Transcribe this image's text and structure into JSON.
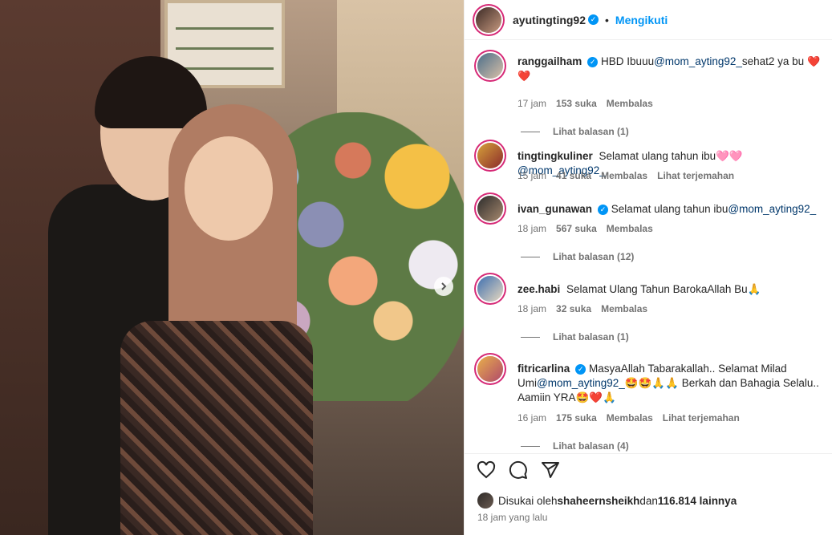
{
  "post": {
    "author": "ayutingting92",
    "follow_status": "Mengikuti",
    "separator": "•"
  },
  "comments": [
    {
      "username": "ranggailham",
      "verified": true,
      "text_before": "HBD Ibuuu",
      "mention": "@mom_ayting92_",
      "text_after": "sehat2 ya bu",
      "emoji": "❤️ ❤️",
      "time": "17 jam",
      "likes": "153 suka",
      "reply": "Membalas",
      "view_replies": "Lihat balasan (1)"
    },
    {
      "username": "tingtingkuliner",
      "verified": false,
      "text_before": "Selamat ulang tahun ibu🩷🩷",
      "mention": "@mom_ayting92_",
      "time": "15 jam",
      "likes": "41 suka",
      "reply": "Membalas",
      "translate": "Lihat terjemahan"
    },
    {
      "username": "ivan_gunawan",
      "verified": true,
      "text_before": "Selamat ulang tahun ibu",
      "mention": "@mom_ayting92_",
      "time": "18 jam",
      "likes": "567 suka",
      "reply": "Membalas",
      "view_replies": "Lihat balasan (12)"
    },
    {
      "username": "zee.habi",
      "verified": false,
      "text_before": "Selamat Ulang Tahun BarokaAllah Bu",
      "emoji": "🙏",
      "time": "18 jam",
      "likes": "32 suka",
      "reply": "Membalas",
      "view_replies": "Lihat balasan (1)"
    },
    {
      "username": "fitricarlina",
      "verified": true,
      "text_before": "MasyaAllah Tabarakallah.. Selamat Milad Umi",
      "mention": "@mom_ayting92_",
      "text_after": "🤩🤩🙏🙏 Berkah dan Bahagia Selalu.. Aamiin YRA🤩❤️🙏",
      "time": "16 jam",
      "likes": "175 suka",
      "reply": "Membalas",
      "translate": "Lihat terjemahan",
      "view_replies": "Lihat balasan (4)"
    }
  ],
  "footer": {
    "liked_prefix": "Disukai oleh ",
    "liked_user": "shaheernsheikh",
    "liked_mid": " dan ",
    "liked_count": "116.814 lainnya",
    "time": "18 jam yang lalu"
  },
  "icons": [
    "heart-icon",
    "comment-icon",
    "share-icon",
    "chevron-right-icon",
    "verified-badge-icon"
  ],
  "colors": {
    "accent": "#0095f6",
    "mention": "#00376b",
    "muted": "#737373"
  }
}
